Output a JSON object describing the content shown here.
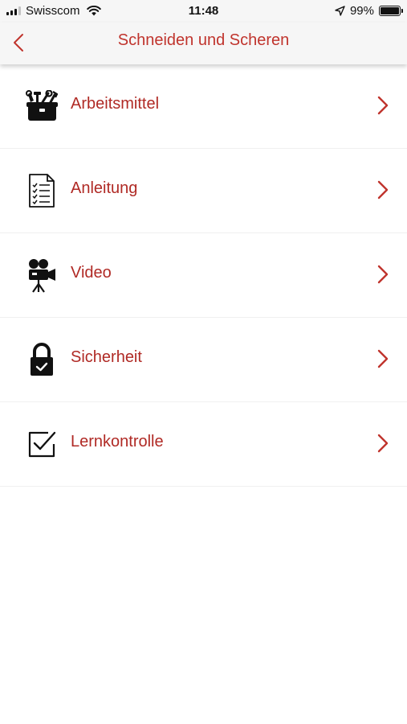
{
  "status_bar": {
    "carrier": "Swisscom",
    "time": "11:48",
    "battery": "99%",
    "battery_level": 0.99
  },
  "nav": {
    "title": "Schneiden und Scheren",
    "back_icon": "chevron-left-icon"
  },
  "colors": {
    "accent": "#c0342d",
    "label": "#b02a25",
    "bar_background": "#f6f6f6"
  },
  "menu": {
    "items": [
      {
        "label": "Arbeitsmittel",
        "icon": "toolbox-icon"
      },
      {
        "label": "Anleitung",
        "icon": "checklist-document-icon"
      },
      {
        "label": "Video",
        "icon": "movie-camera-icon"
      },
      {
        "label": "Sicherheit",
        "icon": "padlock-check-icon"
      },
      {
        "label": "Lernkontrolle",
        "icon": "checkbox-icon"
      }
    ]
  }
}
